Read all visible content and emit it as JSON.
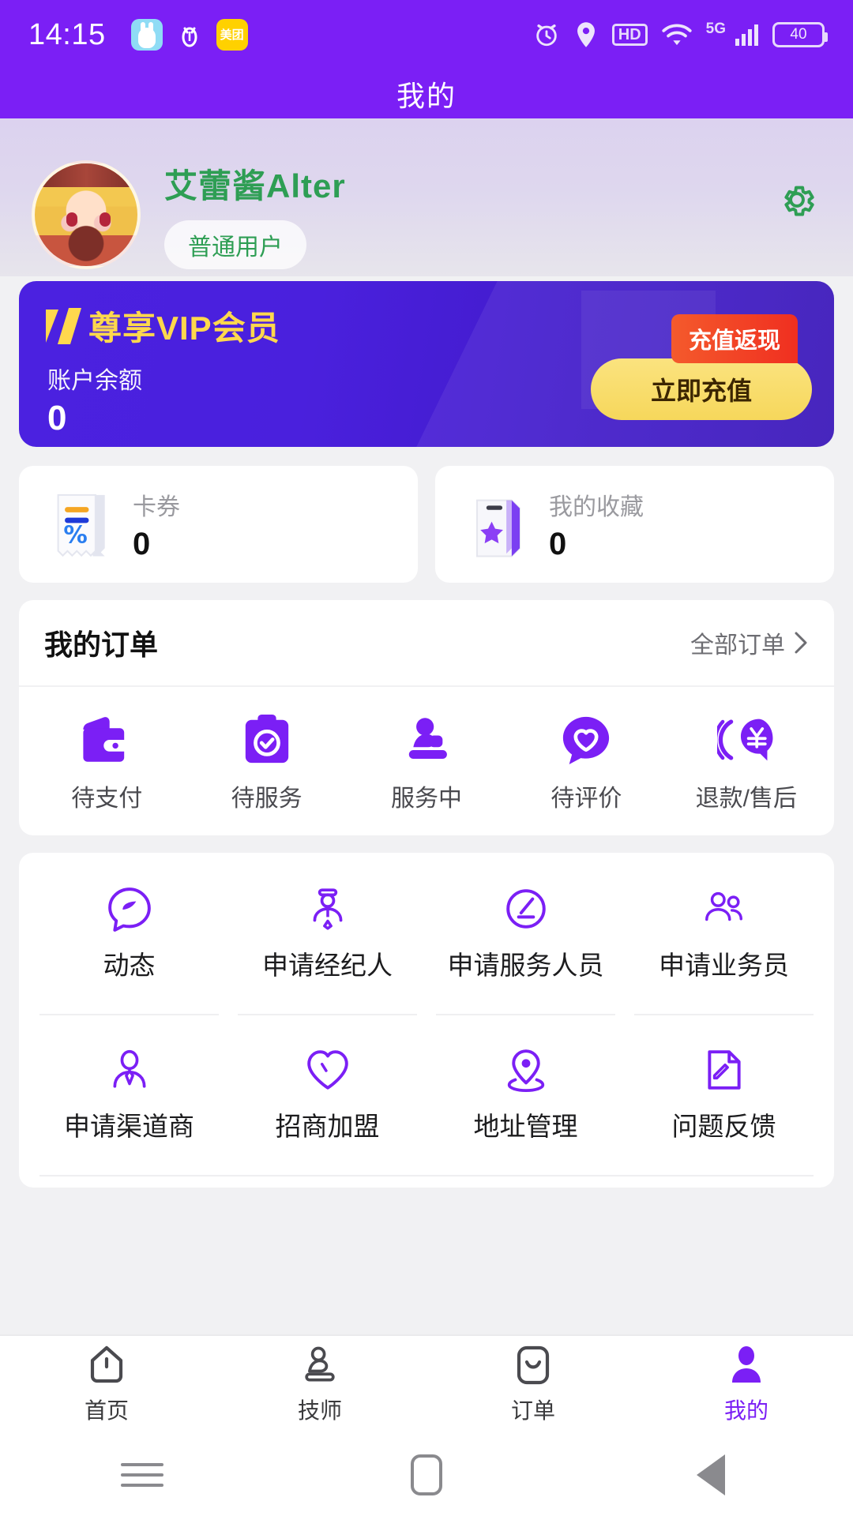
{
  "statusbar": {
    "time": "14:15",
    "app_icons": [
      "rabbit-app-icon",
      "bug-app-icon",
      "meituan-app-icon"
    ],
    "meituan_label": "美团",
    "right_icons": [
      "alarm-icon",
      "location-icon",
      "hd-icon",
      "wifi-icon",
      "5g-icon",
      "signal-icon",
      "battery-icon"
    ],
    "hd_label": "HD",
    "network_label": "5G",
    "battery_level": "40"
  },
  "titlebar": {
    "title": "我的"
  },
  "profile": {
    "username": "艾蕾酱Alter",
    "badge": "普通用户",
    "settings_icon": "gear-icon"
  },
  "vip": {
    "title": "尊享VIP会员",
    "balance_label": "账户余额",
    "balance_value": "0",
    "cashback_label": "充值返现",
    "recharge_label": "立即充值"
  },
  "minicards": [
    {
      "icon": "coupon-icon",
      "label": "卡券",
      "value": "0"
    },
    {
      "icon": "favorites-icon",
      "label": "我的收藏",
      "value": "0"
    }
  ],
  "orders": {
    "title": "我的订单",
    "all_orders_label": "全部订单",
    "chevron_icon": "chevron-right-icon",
    "items": [
      {
        "icon": "wallet-icon",
        "label": "待支付"
      },
      {
        "icon": "clipboard-check-icon",
        "label": "待服务"
      },
      {
        "icon": "massage-person-icon",
        "label": "服务中"
      },
      {
        "icon": "heart-chat-icon",
        "label": "待评价"
      },
      {
        "icon": "refund-yen-icon",
        "label": "退款/售后"
      }
    ]
  },
  "menu": {
    "rows": [
      [
        {
          "icon": "compass-leaf-icon",
          "label": "动态"
        },
        {
          "icon": "agent-person-icon",
          "label": "申请经纪人"
        },
        {
          "icon": "pencil-circle-icon",
          "label": "申请服务人员"
        },
        {
          "icon": "people-group-icon",
          "label": "申请业务员"
        }
      ],
      [
        {
          "icon": "person-tie-icon",
          "label": "申请渠道商"
        },
        {
          "icon": "heart-outline-icon",
          "label": "招商加盟"
        },
        {
          "icon": "map-pin-icon",
          "label": "地址管理"
        },
        {
          "icon": "edit-note-icon",
          "label": "问题反馈"
        }
      ]
    ]
  },
  "tabbar": {
    "tabs": [
      {
        "icon": "home-icon",
        "label": "首页",
        "active": false
      },
      {
        "icon": "technician-icon",
        "label": "技师",
        "active": false
      },
      {
        "icon": "order-icon",
        "label": "订单",
        "active": false
      },
      {
        "icon": "profile-icon",
        "label": "我的",
        "active": true
      }
    ]
  },
  "navbar": {
    "buttons": [
      {
        "icon": "menu-nav-icon"
      },
      {
        "icon": "home-nav-icon"
      },
      {
        "icon": "back-nav-icon"
      }
    ]
  },
  "colors": {
    "brand_purple": "#7B1FF5",
    "vip_gold": "#FFD84D",
    "cashback_red": "#F03020",
    "username_green": "#2E9E54"
  }
}
